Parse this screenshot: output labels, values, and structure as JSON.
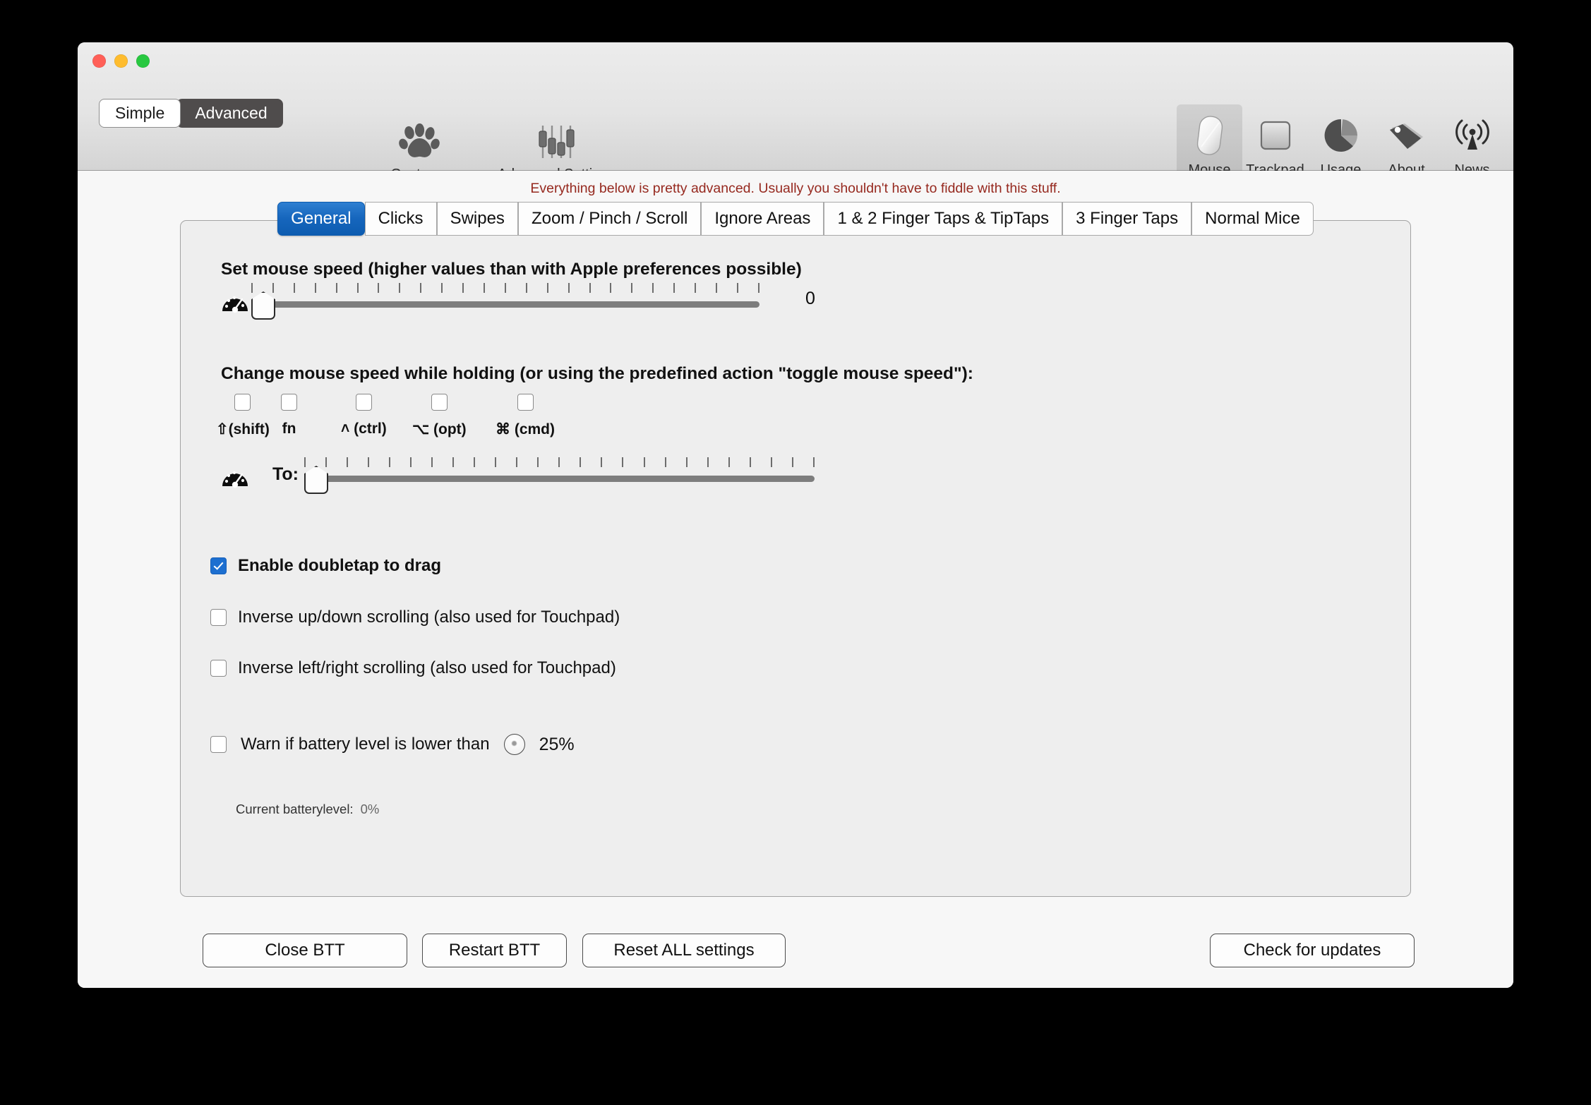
{
  "window": {
    "traffic_lights": [
      "close",
      "minimize",
      "zoom"
    ]
  },
  "toolbar": {
    "mode_simple": "Simple",
    "mode_advanced": "Advanced",
    "gestures_label": "Gestures",
    "advanced_settings_label": "Advanced Settings",
    "right_items": [
      {
        "label": "Mouse",
        "icon": "mouse-icon",
        "active": true
      },
      {
        "label": "Trackpad",
        "icon": "trackpad-icon",
        "active": false
      },
      {
        "label": "Usage",
        "icon": "pie-chart-icon",
        "active": false
      },
      {
        "label": "About",
        "icon": "tag-icon",
        "active": false
      },
      {
        "label": "News",
        "icon": "broadcast-icon",
        "active": false
      }
    ]
  },
  "warning_text": "Everything below is pretty advanced. Usually you shouldn't have to fiddle with this stuff.",
  "tabs": [
    {
      "label": "General",
      "selected": true
    },
    {
      "label": "Clicks",
      "selected": false
    },
    {
      "label": "Swipes",
      "selected": false
    },
    {
      "label": "Zoom / Pinch / Scroll",
      "selected": false
    },
    {
      "label": "Ignore Areas",
      "selected": false
    },
    {
      "label": "1 & 2 Finger Taps & TipTaps",
      "selected": false
    },
    {
      "label": "3 Finger Taps",
      "selected": false
    },
    {
      "label": "Normal Mice",
      "selected": false
    }
  ],
  "general": {
    "speed_heading": "Set mouse speed (higher values than with Apple preferences possible)",
    "speed_value": "0",
    "hold_heading": "Change mouse speed while holding (or using the predefined action \"toggle mouse speed\"):",
    "modifiers": [
      {
        "label": "⇧(shift)",
        "checked": false
      },
      {
        "label": "fn",
        "checked": false
      },
      {
        "label": "˄ (ctrl)",
        "checked": false
      },
      {
        "label": "⌥ (opt)",
        "checked": false
      },
      {
        "label": "⌘ (cmd)",
        "checked": false
      }
    ],
    "to_label": "To:",
    "options": [
      {
        "label": "Enable doubletap to drag",
        "checked": true,
        "bold": true
      },
      {
        "label": "Inverse up/down scrolling (also used for Touchpad)",
        "checked": false,
        "bold": false
      },
      {
        "label": "Inverse left/right scrolling (also used for Touchpad)",
        "checked": false,
        "bold": false
      }
    ],
    "battery_warn_label": "Warn if battery level is lower than",
    "battery_warn_checked": false,
    "battery_threshold": "25%",
    "battery_current_label": "Current batterylevel:",
    "battery_current_value": "0%"
  },
  "footer": {
    "close_btt": "Close BTT",
    "restart_btt": "Restart BTT",
    "reset_all": "Reset ALL settings",
    "check_updates": "Check for updates"
  },
  "colors": {
    "accent_blue": "#1666bd",
    "warning_red": "#96291f",
    "toolbar_top": "#ececec",
    "toolbar_bottom": "#d4d4d4",
    "panel_bg": "#eeeeee"
  }
}
